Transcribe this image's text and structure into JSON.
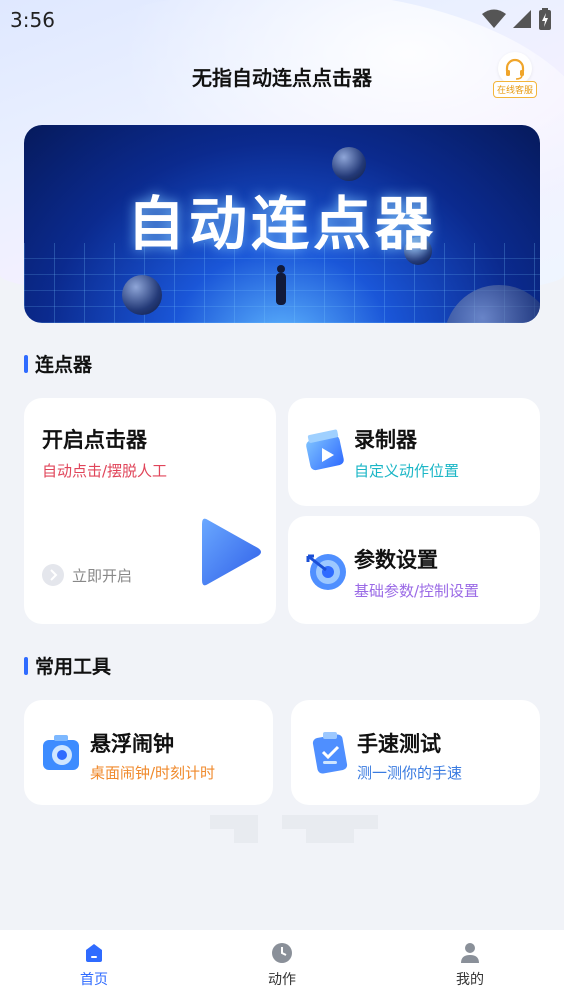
{
  "status_bar": {
    "time": "3:56"
  },
  "header": {
    "title": "无指自动连点点击器",
    "service_label": "在线客服"
  },
  "banner": {
    "title": "自动连点器"
  },
  "section_clicker": {
    "title": "连点器"
  },
  "clicker_card": {
    "title": "开启点击器",
    "subtitle": "自动点击/摆脱人工",
    "start_label": "立即开启"
  },
  "recorder_card": {
    "title": "录制器",
    "subtitle": "自定义动作位置"
  },
  "params_card": {
    "title": "参数设置",
    "subtitle": "基础参数/控制设置"
  },
  "section_tools": {
    "title": "常用工具"
  },
  "alarm_card": {
    "title": "悬浮闹钟",
    "subtitle": "桌面闹钟/时刻计时"
  },
  "speed_card": {
    "title": "手速测试",
    "subtitle": "测一测你的手速"
  },
  "bottom_nav": {
    "items": [
      {
        "label": "首页"
      },
      {
        "label": "动作"
      },
      {
        "label": "我的"
      }
    ],
    "active_index": 0
  },
  "colors": {
    "accent": "#2f6bff",
    "clicker_sub": "#e0455a",
    "recorder_sub": "#1ab6c6",
    "params_sub": "#9a6ae6",
    "alarm_sub": "#f08a2c",
    "speed_sub": "#3a7be0"
  }
}
